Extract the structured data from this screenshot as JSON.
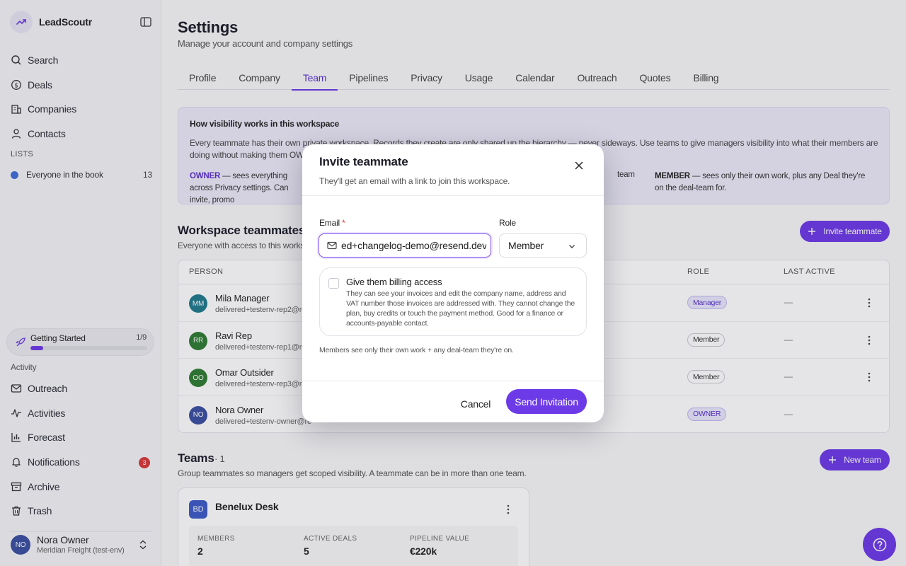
{
  "sidebar": {
    "brand": "LeadScoutr",
    "nav": [
      {
        "label": "Search",
        "icon": "search-icon"
      },
      {
        "label": "Deals",
        "icon": "dollar-icon"
      },
      {
        "label": "Companies",
        "icon": "building-icon"
      },
      {
        "label": "Contacts",
        "icon": "person-icon"
      }
    ],
    "lists_header": "LISTS",
    "list_item": {
      "label": "Everyone in the book",
      "count": "13",
      "color": "#3f6ed8"
    },
    "getting_started": {
      "label": "Getting Started",
      "count": "1/9",
      "progress": 0.11
    },
    "activity_header": "Activity",
    "activity_nav": [
      {
        "label": "Outreach",
        "icon": "mail-icon"
      },
      {
        "label": "Activities",
        "icon": "activity-icon"
      },
      {
        "label": "Forecast",
        "icon": "chart-icon"
      },
      {
        "label": "Notifications",
        "icon": "bell-icon",
        "badge": "3"
      },
      {
        "label": "Archive",
        "icon": "archive-icon"
      },
      {
        "label": "Trash",
        "icon": "trash-icon"
      }
    ],
    "user": {
      "initials": "NO",
      "name": "Nora Owner",
      "org": "Meridian Freight (test-env)"
    }
  },
  "main": {
    "title": "Settings",
    "subtitle": "Manage your account and company settings",
    "tabs": [
      "Profile",
      "Company",
      "Team",
      "Pipelines",
      "Privacy",
      "Usage",
      "Calendar",
      "Outreach",
      "Quotes",
      "Billing"
    ],
    "active_tab": "Team",
    "info": {
      "title": "How visibility works in this workspace",
      "text": "Every teammate has their own private workspace. Records they create are only shared up the hierarchy — never sideways. Use teams to give managers visibility into what their members are doing without making them OWNER.",
      "owner_label": "OWNER",
      "owner_text": " — sees everything across Privacy settings. Can invite, promo",
      "team_fragment": "team",
      "member_label": "MEMBER",
      "member_text": " — sees only their own work, plus any Deal they're on the deal-team for."
    },
    "workspace_title": "Workspace teammates",
    "workspace_sub": "Everyone with access to this worksp",
    "invite_button": "Invite teammate",
    "columns": {
      "person": "PERSON",
      "role": "ROLE",
      "last_active": "LAST ACTIVE"
    },
    "rows": [
      {
        "initials": "MM",
        "name": "Mila Manager",
        "email": "delivered+testenv-rep2@re",
        "role": "Manager",
        "last_active": "—",
        "color": "#1f7a8c"
      },
      {
        "initials": "RR",
        "name": "Ravi Rep",
        "email": "delivered+testenv-rep1@re",
        "role": "Member",
        "last_active": "—",
        "color": "#2e7d32"
      },
      {
        "initials": "OO",
        "name": "Omar Outsider",
        "email": "delivered+testenv-rep3@re",
        "role": "Member",
        "last_active": "—",
        "color": "#2e7d32"
      },
      {
        "initials": "NO",
        "name": "Nora Owner",
        "email": "delivered+testenv-owner@re",
        "role": "OWNER",
        "last_active": "—",
        "color": "#3b4fa0"
      }
    ],
    "teams_title": "Teams",
    "teams_count": "· 1",
    "teams_sub": "Group teammates so managers get scoped visibility. A teammate can be in more than one team.",
    "new_team_button": "New team",
    "team": {
      "initials": "BD",
      "name": "Benelux Desk",
      "stats": [
        {
          "label": "MEMBERS",
          "value": "2"
        },
        {
          "label": "ACTIVE DEALS",
          "value": "5"
        },
        {
          "label": "PIPELINE VALUE",
          "value": "€220k"
        }
      ]
    }
  },
  "modal": {
    "title": "Invite teammate",
    "subtitle": "They'll get an email with a link to join this workspace.",
    "email_label": "Email",
    "required_mark": "*",
    "email_value": "ed+changelog-demo@resend.dev",
    "role_label": "Role",
    "role_value": "Member",
    "billing_title": "Give them billing access",
    "billing_desc": "They can see your invoices and edit the company name, address and VAT number those invoices are addressed with. They cannot change the plan, buy credits or touch the payment method. Good for a finance or accounts-payable contact.",
    "note": "Members see only their own work + any deal-team they're on.",
    "cancel": "Cancel",
    "send": "Send Invitation"
  },
  "colors": {
    "accent": "#6d3ae8",
    "danger": "#d93a3a"
  }
}
